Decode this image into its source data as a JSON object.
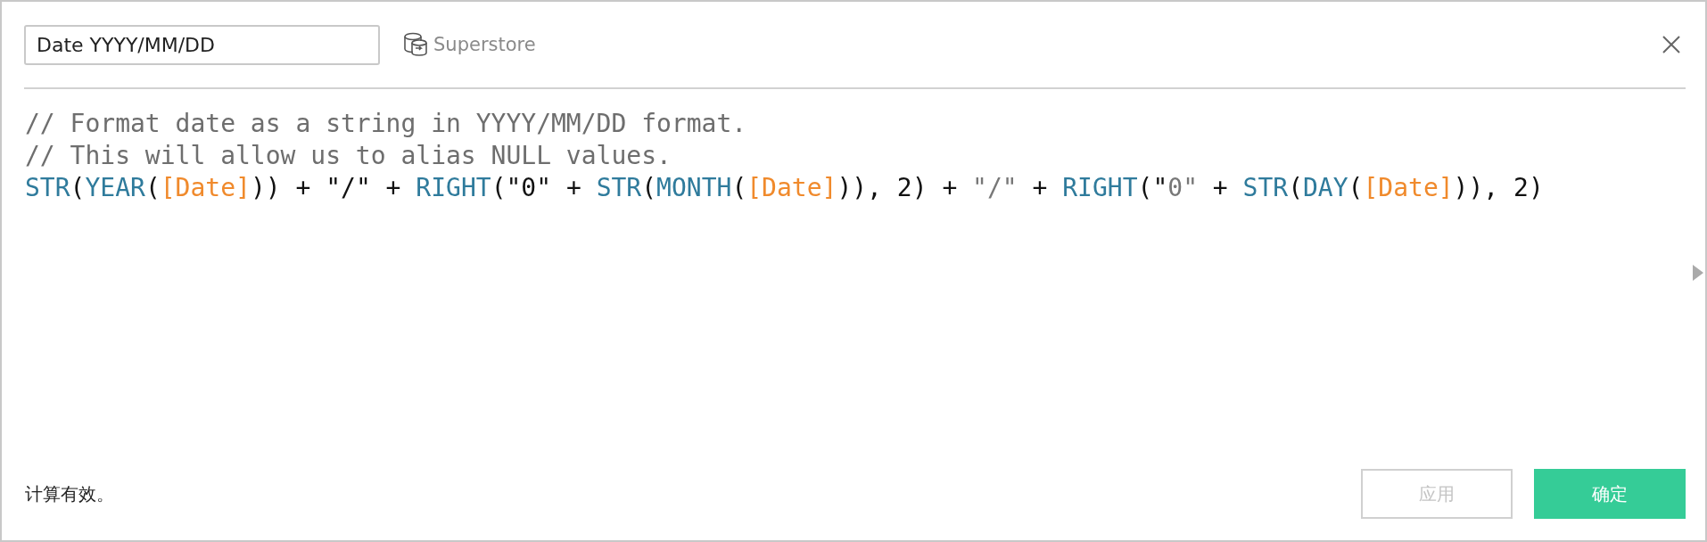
{
  "header": {
    "name_field": {
      "value": "Date YYYY/MM/DD"
    },
    "data_source": "Superstore"
  },
  "code_lines": [
    {
      "segments": [
        {
          "kind": "comment",
          "text": "// Format date as a string in YYYY/MM/DD format."
        }
      ]
    },
    {
      "segments": [
        {
          "kind": "comment",
          "text": "// This will allow us to alias NULL values."
        }
      ]
    },
    {
      "segments": [
        {
          "kind": "function",
          "text": "STR"
        },
        {
          "kind": "plain",
          "text": "("
        },
        {
          "kind": "function",
          "text": "YEAR"
        },
        {
          "kind": "plain",
          "text": "("
        },
        {
          "kind": "field",
          "text": "[Date]"
        },
        {
          "kind": "plain",
          "text": ")) + \"/\" + "
        },
        {
          "kind": "function",
          "text": "RIGHT"
        },
        {
          "kind": "plain",
          "text": "(\"0\" + "
        },
        {
          "kind": "function",
          "text": "STR"
        },
        {
          "kind": "plain",
          "text": "("
        },
        {
          "kind": "function",
          "text": "MONTH"
        },
        {
          "kind": "plain",
          "text": "("
        },
        {
          "kind": "field",
          "text": "[Date]"
        },
        {
          "kind": "plain",
          "text": ")), 2) + "
        },
        {
          "kind": "string",
          "text": "\"/\""
        },
        {
          "kind": "plain",
          "text": " + "
        },
        {
          "kind": "function",
          "text": "RIGHT"
        },
        {
          "kind": "plain",
          "text": "(\""
        },
        {
          "kind": "string",
          "text": "0\""
        },
        {
          "kind": "plain",
          "text": " + "
        },
        {
          "kind": "function",
          "text": "STR"
        },
        {
          "kind": "plain",
          "text": "("
        },
        {
          "kind": "function",
          "text": "DAY"
        },
        {
          "kind": "plain",
          "text": "("
        },
        {
          "kind": "field",
          "text": "[Date]"
        },
        {
          "kind": "plain",
          "text": ")), 2)"
        }
      ]
    }
  ],
  "status": "计算有效。",
  "buttons": [
    {
      "label": "应用",
      "kind": "secondary",
      "disabled": true
    },
    {
      "label": "确定",
      "kind": "primary",
      "disabled": false
    }
  ]
}
